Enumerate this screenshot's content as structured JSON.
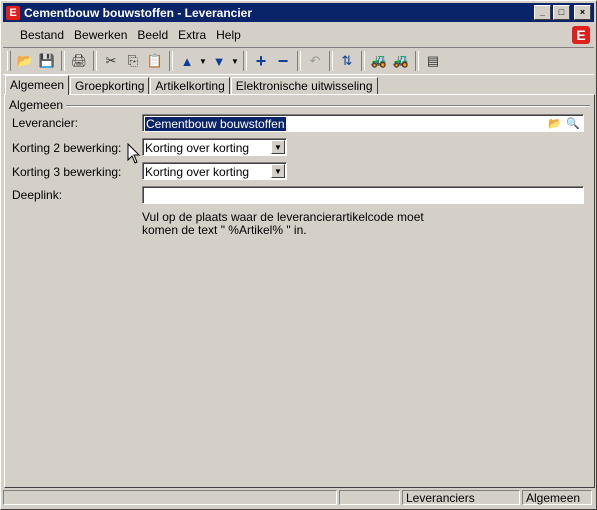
{
  "window": {
    "title": "Cementbouw bouwstoffen - Leverancier",
    "app_icon": "E"
  },
  "title_buttons": {
    "minimize": "_",
    "maximize": "□",
    "close": "×"
  },
  "menu": {
    "items": [
      "Bestand",
      "Bewerken",
      "Beeld",
      "Extra",
      "Help"
    ],
    "logo": "E"
  },
  "toolbar": {
    "buttons": [
      {
        "name": "open-icon",
        "glyph": "📂",
        "disabled": true
      },
      {
        "name": "save-icon",
        "glyph": "💾",
        "disabled": true
      },
      {
        "name": "print-icon",
        "glyph": "🖨"
      },
      {
        "name": "cut-icon",
        "glyph": "✂"
      },
      {
        "name": "copy-icon",
        "glyph": "⎘"
      },
      {
        "name": "paste-icon",
        "glyph": "📋"
      },
      {
        "name": "previous-icon",
        "glyph": "▲"
      },
      {
        "name": "next-icon",
        "glyph": "▼"
      },
      {
        "name": "add-icon",
        "glyph": "+"
      },
      {
        "name": "remove-icon",
        "glyph": "−"
      },
      {
        "name": "undo-icon",
        "glyph": "↶",
        "disabled": true
      },
      {
        "name": "refresh-icon",
        "glyph": "⇅"
      },
      {
        "name": "forklift-icon",
        "glyph": "🚜"
      },
      {
        "name": "forklift-alt-icon",
        "glyph": "🚜"
      },
      {
        "name": "window-icon",
        "glyph": "▤"
      }
    ]
  },
  "tabs": [
    {
      "label": "Algemeen",
      "active": true
    },
    {
      "label": "Groepkorting"
    },
    {
      "label": "Artikelkorting"
    },
    {
      "label": "Elektronische uitwisseling"
    }
  ],
  "group": {
    "title": "Algemeen"
  },
  "form": {
    "leverancier_label": "Leverancier:",
    "leverancier_value": "Cementbouw bouwstoffen",
    "korting2_label": "Korting 2 bewerking:",
    "korting2_value": "Korting over korting",
    "korting3_label": "Korting 3 bewerking:",
    "korting3_value": "Korting over korting",
    "deeplink_label": "Deeplink:",
    "deeplink_value": "",
    "hint_line1": "Vul op de plaats waar de leverancierartikelcode moet",
    "hint_line2": "komen de text \"  %Artikel%  \" in."
  },
  "status": {
    "cells": [
      "",
      "",
      "Leveranciers",
      "Algemeen"
    ]
  }
}
